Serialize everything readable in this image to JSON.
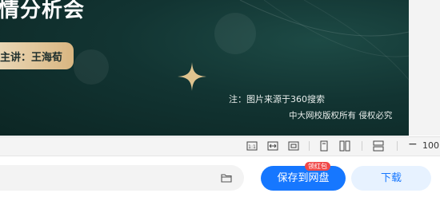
{
  "slide": {
    "title": "情分析会",
    "lecturer": "主讲：王海荀",
    "note": "注：图片来源于360搜索",
    "copyright": "中大网校版权所有 侵权必究"
  },
  "toolbar": {
    "icons": [
      "fit-size-icon",
      "fit-width-icon",
      "fit-page-icon",
      "single-page-icon",
      "two-page-icon",
      "continuous-scroll-icon",
      "zoom-out-icon"
    ],
    "zoom": "100"
  },
  "footer": {
    "save_label": "保存到网盘",
    "badge": "领红包",
    "download_label": "下载"
  },
  "colors": {
    "slide_bg": "#123432",
    "accent_gold": "#d9b681",
    "primary": "#1677ff",
    "badge_red": "#f04848"
  }
}
